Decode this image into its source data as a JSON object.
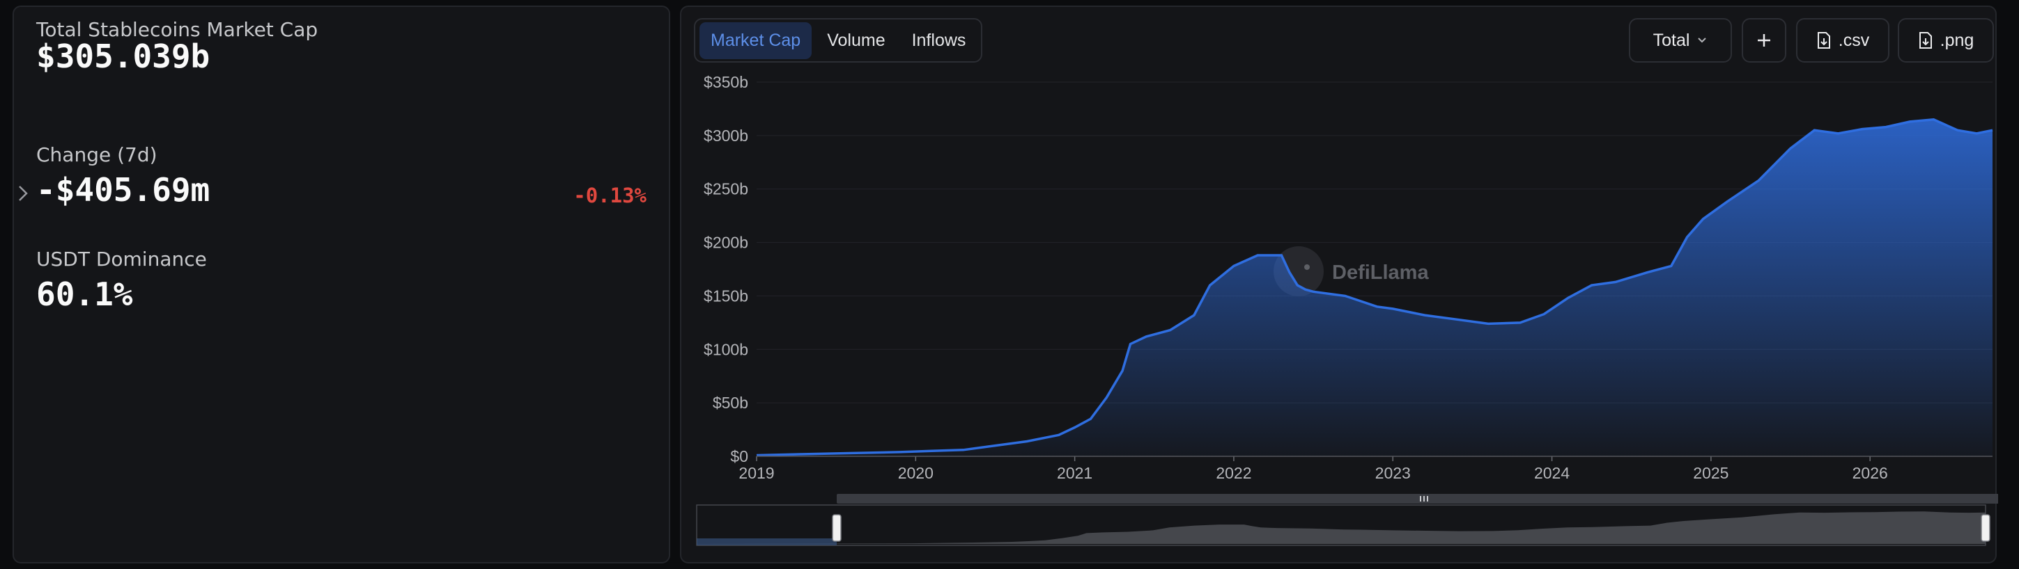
{
  "stats": {
    "market_cap_label": "Total Stablecoins Market Cap",
    "market_cap_value": "$305.039b",
    "change_label": "Change (7d)",
    "change_value": "-$405.69m",
    "change_percent": "-0.13%",
    "dominance_label": "USDT Dominance",
    "dominance_value": "60.1%"
  },
  "tabs": [
    {
      "label": "Market Cap",
      "active": true
    },
    {
      "label": "Volume",
      "active": false
    },
    {
      "label": "Inflows",
      "active": false
    }
  ],
  "toolbar": {
    "total_label": "Total",
    "csv_label": ".csv",
    "png_label": ".png"
  },
  "watermark": "DefiLlama",
  "colors": {
    "accent": "#2f6ee0",
    "negative": "#e0483f",
    "active_tab_bg": "#1c2a48",
    "active_tab_text": "#5d8fe8"
  },
  "chart_data": {
    "type": "area",
    "title": "",
    "xlabel": "",
    "ylabel": "",
    "grid": true,
    "xlim": [
      2019.0,
      2026.77
    ],
    "ylim": [
      0,
      350
    ],
    "x_ticks": [
      "2019",
      "2020",
      "2021",
      "2022",
      "2023",
      "2024",
      "2025",
      "2026"
    ],
    "y_ticks": [
      "$0",
      "$50b",
      "$100b",
      "$150b",
      "$200b",
      "$250b",
      "$300b",
      "$350b"
    ],
    "series": [
      {
        "x": [
          2019.0,
          2019.3,
          2019.6,
          2019.9,
          2020.1,
          2020.3,
          2020.5,
          2020.7,
          2020.9,
          2021.0,
          2021.1,
          2021.2,
          2021.3,
          2021.35,
          2021.45,
          2021.6,
          2021.75,
          2021.85,
          2022.0,
          2022.15,
          2022.3,
          2022.35,
          2022.4,
          2022.45,
          2022.5,
          2022.7,
          2022.9,
          2023.0,
          2023.2,
          2023.4,
          2023.6,
          2023.8,
          2023.95,
          2024.1,
          2024.25,
          2024.4,
          2024.6,
          2024.75,
          2024.85,
          2024.95,
          2025.1,
          2025.3,
          2025.5,
          2025.65,
          2025.8,
          2025.95,
          2026.1,
          2026.25,
          2026.4,
          2026.55,
          2026.67,
          2026.77
        ],
        "values": [
          1,
          2,
          3,
          4,
          5,
          6,
          10,
          14,
          20,
          27,
          35,
          55,
          80,
          105,
          112,
          118,
          132,
          160,
          178,
          188,
          188,
          172,
          160,
          156,
          154,
          150,
          140,
          138,
          132,
          128,
          124,
          125,
          133,
          148,
          160,
          163,
          172,
          178,
          205,
          222,
          238,
          258,
          288,
          305,
          302,
          306,
          308,
          313,
          315,
          305,
          302,
          305
        ]
      }
    ]
  }
}
